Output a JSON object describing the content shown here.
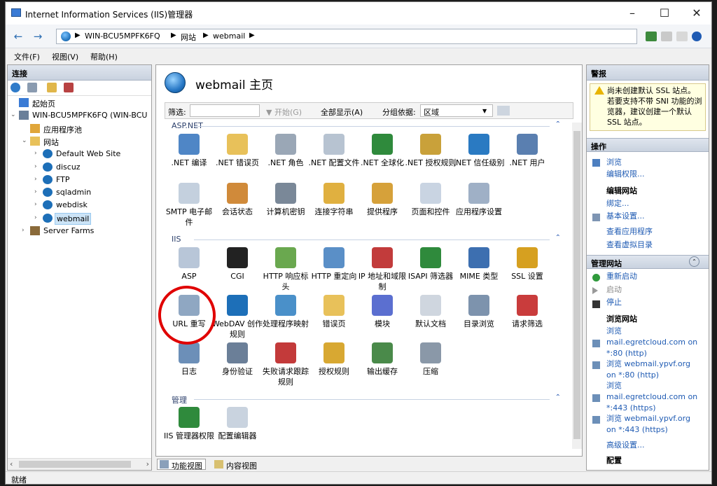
{
  "window": {
    "title": "Internet Information Services (IIS)管理器",
    "min": "–",
    "max": "☐",
    "close": "✕"
  },
  "address": {
    "crumbs": [
      "WIN-BCU5MPFK6FQ",
      "网站",
      "webmail"
    ],
    "sep": "▶"
  },
  "menu": [
    "文件(F)",
    "视图(V)",
    "帮助(H)"
  ],
  "connections": {
    "title": "连接",
    "tree": [
      {
        "label": "起始页",
        "level": 1,
        "exp": "",
        "icon": "start-page-icon",
        "color": "#3a7bd5"
      },
      {
        "label": "WIN-BCU5MPFK6FQ (WIN-BCU",
        "level": 1,
        "exp": "⌄",
        "icon": "server-icon",
        "color": "#6a7f99"
      },
      {
        "label": "应用程序池",
        "level": 2,
        "exp": "",
        "icon": "app-pool-icon",
        "color": "#e0a63a"
      },
      {
        "label": "网站",
        "level": 2,
        "exp": "⌄",
        "icon": "sites-folder-icon",
        "color": "#e8c15a"
      },
      {
        "label": "Default Web Site",
        "level": 3,
        "exp": "›",
        "icon": "site-globe-icon",
        "color": "#1d6fb8"
      },
      {
        "label": "discuz",
        "level": 3,
        "exp": "›",
        "icon": "site-globe-icon",
        "color": "#1d6fb8"
      },
      {
        "label": "FTP",
        "level": 3,
        "exp": "›",
        "icon": "site-globe-icon",
        "color": "#1d6fb8"
      },
      {
        "label": "sqladmin",
        "level": 3,
        "exp": "›",
        "icon": "site-globe-icon",
        "color": "#1d6fb8"
      },
      {
        "label": "webdisk",
        "level": 3,
        "exp": "›",
        "icon": "site-globe-icon",
        "color": "#1d6fb8"
      },
      {
        "label": "webmail",
        "level": 3,
        "exp": "›",
        "icon": "site-globe-icon",
        "color": "#1d6fb8",
        "selected": true
      },
      {
        "label": "Server Farms",
        "level": 2,
        "exp": "›",
        "icon": "server-farms-icon",
        "color": "#8a6a3a"
      }
    ]
  },
  "center": {
    "title": "webmail 主页",
    "filter": {
      "label": "筛选:",
      "start": "▼ 开始(G)",
      "showall": "全部显示(A)",
      "groupby": "分组依据:",
      "groupval": "区域"
    },
    "groups": [
      {
        "name": "ASP.NET",
        "items": [
          {
            "label": ".NET 编译",
            "icon": "dotnet-compilation-icon",
            "color": "#4f86c6"
          },
          {
            "label": ".NET 错误页",
            "icon": "dotnet-error-pages-icon",
            "color": "#e8c15a"
          },
          {
            "label": ".NET 角色",
            "icon": "dotnet-roles-icon",
            "color": "#9aa7b6"
          },
          {
            "label": ".NET 配置文件",
            "icon": "dotnet-profile-icon",
            "color": "#b7c3d1"
          },
          {
            "label": ".NET 全球化",
            "icon": "dotnet-globalization-icon",
            "color": "#2f8a3c"
          },
          {
            "label": ".NET 授权规则",
            "icon": "dotnet-authorization-icon",
            "color": "#c9a13a"
          },
          {
            "label": ".NET 信任级别",
            "icon": "dotnet-trust-icon",
            "color": "#2a7ac2"
          },
          {
            "label": ".NET 用户",
            "icon": "dotnet-users-icon",
            "color": "#5a7fb0"
          },
          {
            "label": "SMTP 电子邮件",
            "icon": "smtp-email-icon",
            "color": "#c4d0de"
          },
          {
            "label": "会话状态",
            "icon": "session-state-icon",
            "color": "#d08a3a"
          },
          {
            "label": "计算机密钥",
            "icon": "machine-key-icon",
            "color": "#7a8898"
          },
          {
            "label": "连接字符串",
            "icon": "connection-strings-icon",
            "color": "#e0b040"
          },
          {
            "label": "提供程序",
            "icon": "providers-icon",
            "color": "#d6a13a"
          },
          {
            "label": "页面和控件",
            "icon": "pages-controls-icon",
            "color": "#c9d4e2"
          },
          {
            "label": "应用程序设置",
            "icon": "app-settings-icon",
            "color": "#9fb0c6"
          }
        ]
      },
      {
        "name": "IIS",
        "items": [
          {
            "label": "ASP",
            "icon": "asp-icon",
            "color": "#b8c6d8"
          },
          {
            "label": "CGI",
            "icon": "cgi-icon",
            "color": "#222222"
          },
          {
            "label": "HTTP 响应标头",
            "icon": "http-headers-icon",
            "color": "#6aa84f"
          },
          {
            "label": "HTTP 重定向",
            "icon": "http-redirect-icon",
            "color": "#5a8fc7"
          },
          {
            "label": "IP 地址和域限制",
            "icon": "ip-restrictions-icon",
            "color": "#c23b3b"
          },
          {
            "label": "ISAPI 筛选器",
            "icon": "isapi-filters-icon",
            "color": "#2f8a3c"
          },
          {
            "label": "MIME 类型",
            "icon": "mime-types-icon",
            "color": "#3d6fb0"
          },
          {
            "label": "SSL 设置",
            "icon": "ssl-lock-icon",
            "color": "#d6a020"
          },
          {
            "label": "URL 重写",
            "icon": "url-rewrite-icon",
            "color": "#8fa7c2"
          },
          {
            "label": "WebDAV 创作规则",
            "icon": "webdav-icon",
            "color": "#1d6fb8"
          },
          {
            "label": "处理程序映射",
            "icon": "handler-mappings-icon",
            "color": "#4a90c9"
          },
          {
            "label": "错误页",
            "icon": "error-pages-icon",
            "color": "#e8c15a"
          },
          {
            "label": "模块",
            "icon": "modules-icon",
            "color": "#5b6fd0"
          },
          {
            "label": "默认文档",
            "icon": "default-document-icon",
            "color": "#cfd6df"
          },
          {
            "label": "目录浏览",
            "icon": "directory-browsing-icon",
            "color": "#7d93ad"
          },
          {
            "label": "请求筛选",
            "icon": "request-filtering-icon",
            "color": "#c93c3c"
          },
          {
            "label": "日志",
            "icon": "logging-icon",
            "color": "#6c8fb8"
          },
          {
            "label": "身份验证",
            "icon": "authentication-icon",
            "color": "#6b7f98"
          },
          {
            "label": "失败请求跟踪规则",
            "icon": "failed-request-tracing-icon",
            "color": "#c33a3a"
          },
          {
            "label": "授权规则",
            "icon": "authorization-rules-icon",
            "color": "#d8a832"
          },
          {
            "label": "输出缓存",
            "icon": "output-cache-icon",
            "color": "#4a8a4a"
          },
          {
            "label": "压缩",
            "icon": "compression-icon",
            "color": "#8a98a8"
          }
        ]
      },
      {
        "name": "管理",
        "items": [
          {
            "label": "IIS 管理器权限",
            "icon": "iis-manager-permissions-icon",
            "color": "#2f8a3c"
          },
          {
            "label": "配置编辑器",
            "icon": "configuration-editor-icon",
            "color": "#c9d3df"
          }
        ]
      }
    ],
    "tabs": {
      "features": "功能视图",
      "content": "内容视图"
    }
  },
  "actions": {
    "header": "警报",
    "alert": "尚未创建默认 SSL 站点。若要支持不带 SNI 功能的浏览器，建议创建一个默认 SSL 站点。",
    "ops": "操作",
    "browse": "浏览",
    "editperm": "编辑权限...",
    "editsite": "编辑网站",
    "bind": "绑定...",
    "basic": "基本设置...",
    "viewapps": "查看应用程序",
    "viewvdirs": "查看虚拟目录",
    "manage": "管理网站",
    "restart": "重新启动",
    "start": "启动",
    "stop": "停止",
    "browsesite": "浏览网站",
    "b1": [
      "浏览",
      "mail.egretcloud.com on",
      "*:80 (http)"
    ],
    "b2": [
      "浏览 webmail.ypvf.org",
      "on *:80 (http)"
    ],
    "b3": [
      "浏览",
      "mail.egretcloud.com on",
      "*:443 (https)"
    ],
    "b4": [
      "浏览 webmail.ypvf.org",
      "on *:443 (https)"
    ],
    "advanced": "高级设置...",
    "config": "配置"
  },
  "status": "就绪"
}
